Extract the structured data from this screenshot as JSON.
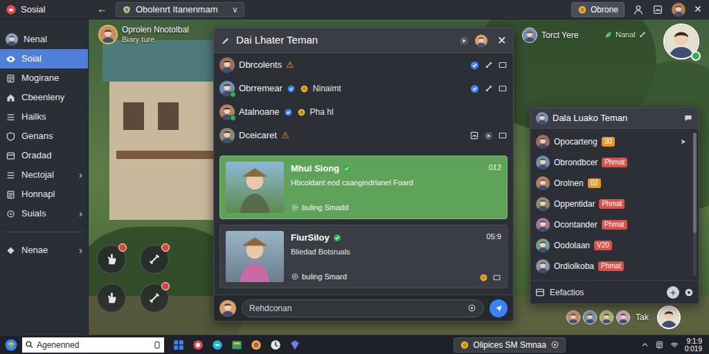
{
  "window": {
    "title": "Sosial"
  },
  "topbar": {
    "back": "←",
    "dropdown": {
      "label": "Obolenrt Itanenmam",
      "chevron": "∨"
    },
    "account": {
      "label": "Obrone"
    },
    "close": "✕"
  },
  "sidebar": {
    "items": [
      {
        "label": "Nenal",
        "selected": false,
        "kind": "profile"
      },
      {
        "label": "Soial",
        "selected": true,
        "kind": "page"
      },
      {
        "label": "Mogirane",
        "selected": false,
        "kind": "page"
      },
      {
        "label": "Cbeenleny",
        "selected": false,
        "kind": "page"
      },
      {
        "label": "Hailks",
        "selected": false,
        "kind": "page"
      },
      {
        "label": "Genans",
        "selected": false,
        "kind": "page"
      },
      {
        "label": "Oradad",
        "selected": false,
        "kind": "page"
      },
      {
        "label": "Nectojal",
        "selected": false,
        "kind": "page",
        "chevron": "›"
      },
      {
        "label": "Honnapl",
        "selected": false,
        "kind": "page"
      },
      {
        "label": "Suials",
        "selected": false,
        "kind": "page",
        "chevron": "›"
      },
      {
        "label": "Nenae",
        "selected": false,
        "kind": "page",
        "chevron": "›"
      }
    ]
  },
  "game": {
    "player": {
      "name": "Oprolen Nnotolbal",
      "subtitle": "Biary ture"
    },
    "nearby": {
      "name": "Torct Yere"
    },
    "status": {
      "label": "Nanal"
    },
    "actions": [
      {
        "alert": true
      },
      {
        "alert": true
      },
      {
        "alert": false
      },
      {
        "alert": true
      }
    ],
    "avatar_row": {
      "label": "Tak"
    }
  },
  "chat_panel": {
    "title": "Dai Lhater Teman",
    "close": "✕",
    "friends": [
      {
        "name": "Dbrcolents",
        "icon": "⚠",
        "online": false
      },
      {
        "name": "Obrremear",
        "note": "Ninaimt",
        "online": true
      },
      {
        "name": "Atalnoane",
        "note": "Pha hl",
        "online": true
      },
      {
        "name": "Dceicaret",
        "icon": "⚠",
        "online": false
      }
    ],
    "messages": [
      {
        "title": "Mhul Siong",
        "subtitle": "Hbcoldant eod csangindrlanel Foard",
        "time": "012",
        "footer": "buling Smadd",
        "highlighted": true
      },
      {
        "title": "FiurSiloy",
        "subtitle": "Bliedad Botsruals",
        "time": "05:9",
        "footer": "buling Smard",
        "highlighted": false
      }
    ],
    "input": {
      "placeholder": "Rehdconan"
    }
  },
  "friends_panel": {
    "title": "Dala Luako Teman",
    "friends": [
      {
        "name": "Opocarteng",
        "badge": "30",
        "color": "#e8962e"
      },
      {
        "name": "Obrondbcer",
        "badge": "Phmat",
        "color": "#d9534a"
      },
      {
        "name": "Orolnen",
        "badge": "02",
        "color": "#e8962e"
      },
      {
        "name": "Oppentidar",
        "badge": "Phmat",
        "color": "#d9534a"
      },
      {
        "name": "Ocontander",
        "badge": "Phmat",
        "color": "#d9534a"
      },
      {
        "name": "Oodolaan",
        "badge": "V20",
        "color": "#d9534a"
      },
      {
        "name": "Ordiolkoba",
        "badge": "Phmat",
        "color": "#d9534a"
      }
    ],
    "footer": {
      "label": "Eefactios",
      "add": "+"
    }
  },
  "taskbar": {
    "search": {
      "placeholder": "Agenenned"
    },
    "task": {
      "label": "Olipices SM Smnaa"
    },
    "clock": {
      "time": "9:1:9",
      "date": "0:019"
    }
  }
}
